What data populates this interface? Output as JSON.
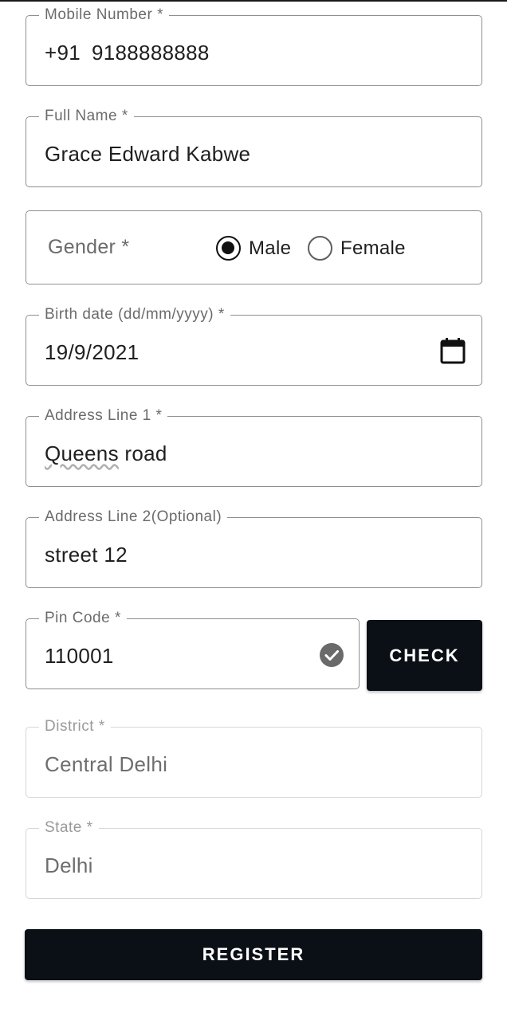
{
  "form": {
    "mobile": {
      "label": "Mobile Number *",
      "prefix": "+91",
      "value": "9188888888"
    },
    "full_name": {
      "label": "Full Name *",
      "value": "Grace Edward Kabwe"
    },
    "gender": {
      "label": "Gender *",
      "options": [
        "Male",
        "Female"
      ],
      "selected": "Male"
    },
    "birth_date": {
      "label": "Birth date  (dd/mm/yyyy) *",
      "value": "19/9/2021"
    },
    "address1": {
      "label": "Address Line 1 *",
      "value_part1": "Queens",
      "value_part2": " road"
    },
    "address2": {
      "label": "Address Line 2(Optional)",
      "value": "street 12"
    },
    "pin_code": {
      "label": "Pin Code *",
      "value": "110001",
      "validated": true
    },
    "district": {
      "label": "District *",
      "value": "Central Delhi",
      "disabled": true
    },
    "state": {
      "label": "State *",
      "value": "Delhi",
      "disabled": true
    }
  },
  "buttons": {
    "check": "CHECK",
    "register": "REGISTER"
  },
  "icons": {
    "calendar": "calendar-icon",
    "check": "check-circle-icon"
  },
  "colors": {
    "button_bg": "#0a1015",
    "border": "#8f8f8f",
    "disabled_border": "#d6d6d6"
  }
}
